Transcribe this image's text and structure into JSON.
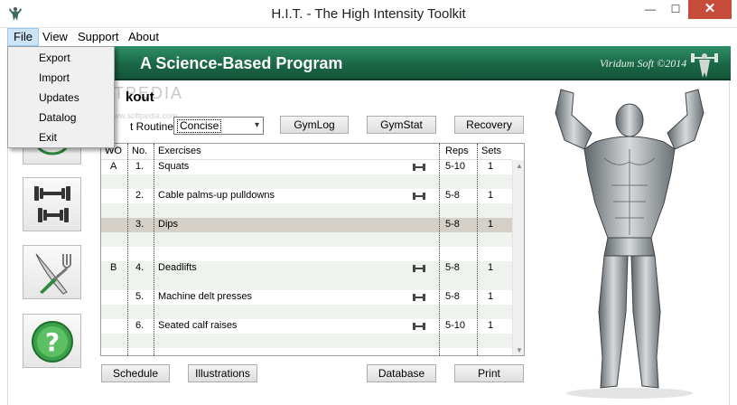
{
  "window": {
    "title": "H.I.T. - The High Intensity Toolkit",
    "minimize": "—",
    "maximize": "☐",
    "close": "✕"
  },
  "menubar": {
    "file": "File",
    "view": "View",
    "support": "Support",
    "about": "About"
  },
  "file_menu": {
    "items": [
      "Export",
      "Import",
      "Updates",
      "Datalog",
      "Exit"
    ]
  },
  "banner": {
    "title": "A Science-Based Program",
    "brand": "Viridum Soft ©2014"
  },
  "watermark": {
    "text": "SOFTPEDIA",
    "url": "www.softpedia.com"
  },
  "workout": {
    "section_title": "kout",
    "routine_label": "t Routine:",
    "routine_value": "Concise",
    "routine_arrow": "▾"
  },
  "buttons": {
    "gymlog": "GymLog",
    "gymstat": "GymStat",
    "recovery": "Recovery",
    "schedule": "Schedule",
    "illustrations": "Illustrations",
    "database": "Database",
    "print": "Print"
  },
  "table": {
    "headers": {
      "wo": "WO",
      "no": "No.",
      "exercises": "Exercises",
      "reps": "Reps",
      "sets": "Sets"
    },
    "rows": [
      {
        "wo": "A",
        "no": "1.",
        "exercise": "Squats",
        "reps": "5-10",
        "sets": "1"
      },
      {
        "wo": "",
        "no": "2.",
        "exercise": "Cable palms-up pulldowns",
        "reps": "5-8",
        "sets": "1"
      },
      {
        "wo": "",
        "no": "3.",
        "exercise": "Dips",
        "reps": "5-8",
        "sets": "1"
      },
      {
        "wo": "B",
        "no": "4.",
        "exercise": "Deadlifts",
        "reps": "5-8",
        "sets": "1"
      },
      {
        "wo": "",
        "no": "5.",
        "exercise": "Machine delt presses",
        "reps": "5-8",
        "sets": "1"
      },
      {
        "wo": "",
        "no": "6.",
        "exercise": "Seated calf raises",
        "reps": "5-10",
        "sets": "1"
      }
    ],
    "scroll_up": "▲",
    "scroll_down": "▼"
  },
  "icons": {
    "app": "muscle-figure-icon",
    "side": [
      "scale-icon",
      "dumbbells-icon",
      "fork-knife-icon",
      "help-icon"
    ],
    "help_glyph": "?"
  },
  "colors": {
    "banner": "#1a6747",
    "selected_row": "#d4d0c8",
    "row_band": "#eef3ee",
    "close": "#c74b3b"
  }
}
